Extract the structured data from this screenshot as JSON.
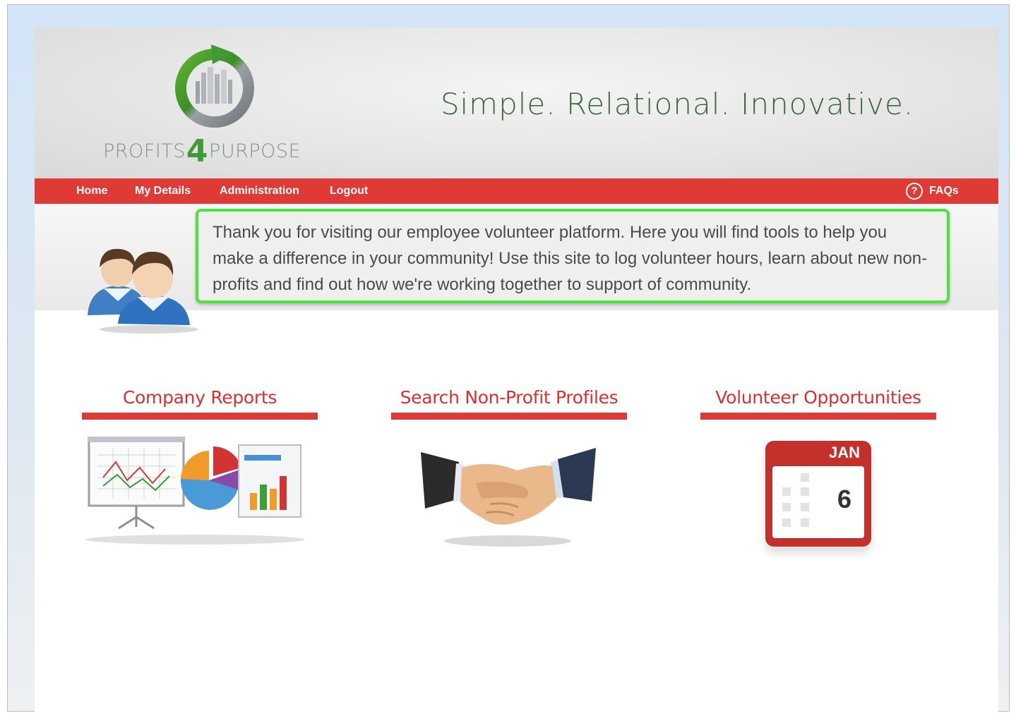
{
  "header": {
    "brand": {
      "left": "PROFITS",
      "number": "4",
      "right": "PURPOSE"
    },
    "tagline": "Simple. Relational. Innovative."
  },
  "nav": {
    "items": [
      {
        "label": "Home"
      },
      {
        "label": "My Details"
      },
      {
        "label": "Administration"
      },
      {
        "label": "Logout"
      }
    ],
    "faq": {
      "icon": "question-icon",
      "symbol": "?",
      "label": "FAQs"
    }
  },
  "welcome": {
    "icon": "users-icon",
    "message": "Thank you for visiting our employee volunteer platform. Here you will find tools to help you make a difference in your community! Use this site to log volunteer hours, learn about new non-profits and find out how we're working together to support of community."
  },
  "sections": [
    {
      "title": "Company Reports",
      "icon": "reports-chart-icon"
    },
    {
      "title": "Search Non-Profit Profiles",
      "icon": "handshake-icon"
    },
    {
      "title": "Volunteer Opportunities",
      "icon": "calendar-icon",
      "calendar": {
        "month": "JAN",
        "day": "6"
      }
    }
  ],
  "colors": {
    "nav_red": "#e03a36",
    "title_red": "#d9302b",
    "highlight_green": "#4ee23a",
    "brand_green": "#3f9a37"
  }
}
